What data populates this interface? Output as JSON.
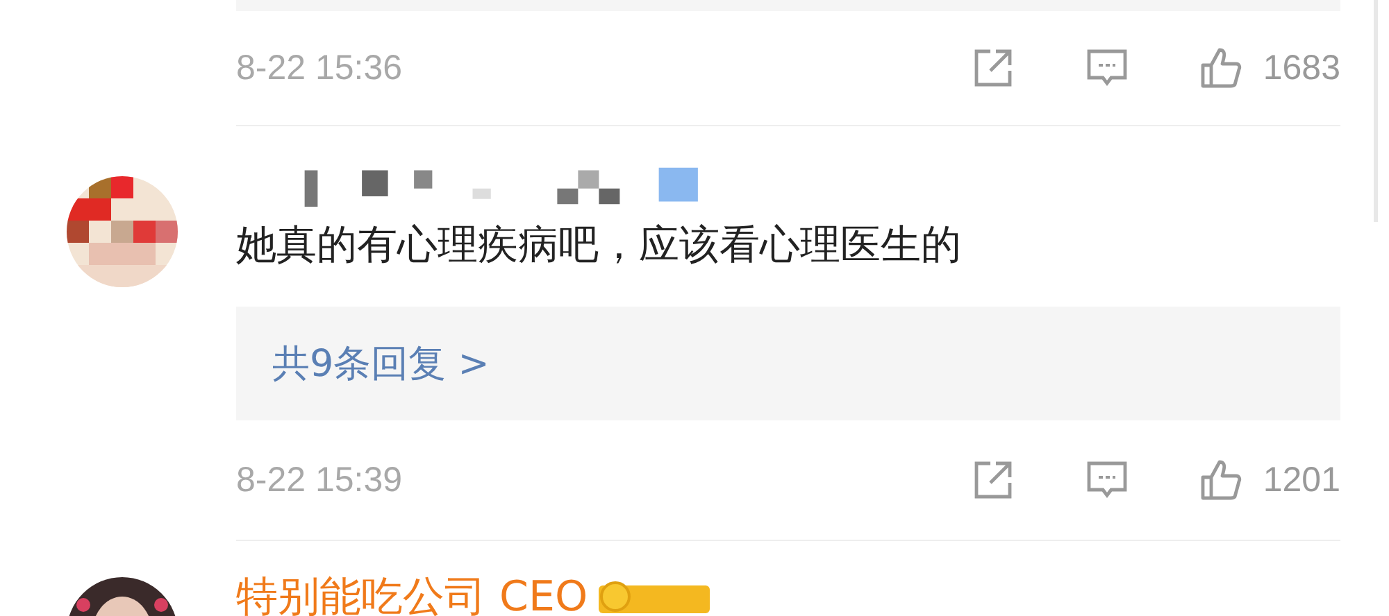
{
  "comments": [
    {
      "kind": "tail",
      "time": "8-22 15:36",
      "likes": "1683"
    },
    {
      "kind": "full",
      "text": "她真的有心理疾病吧，应该看心理医生的",
      "replies": "共9条回复 >",
      "time": "8-22 15:39",
      "likes": "1201"
    },
    {
      "kind": "head",
      "name": "特别能吃公司 CEO"
    }
  ]
}
